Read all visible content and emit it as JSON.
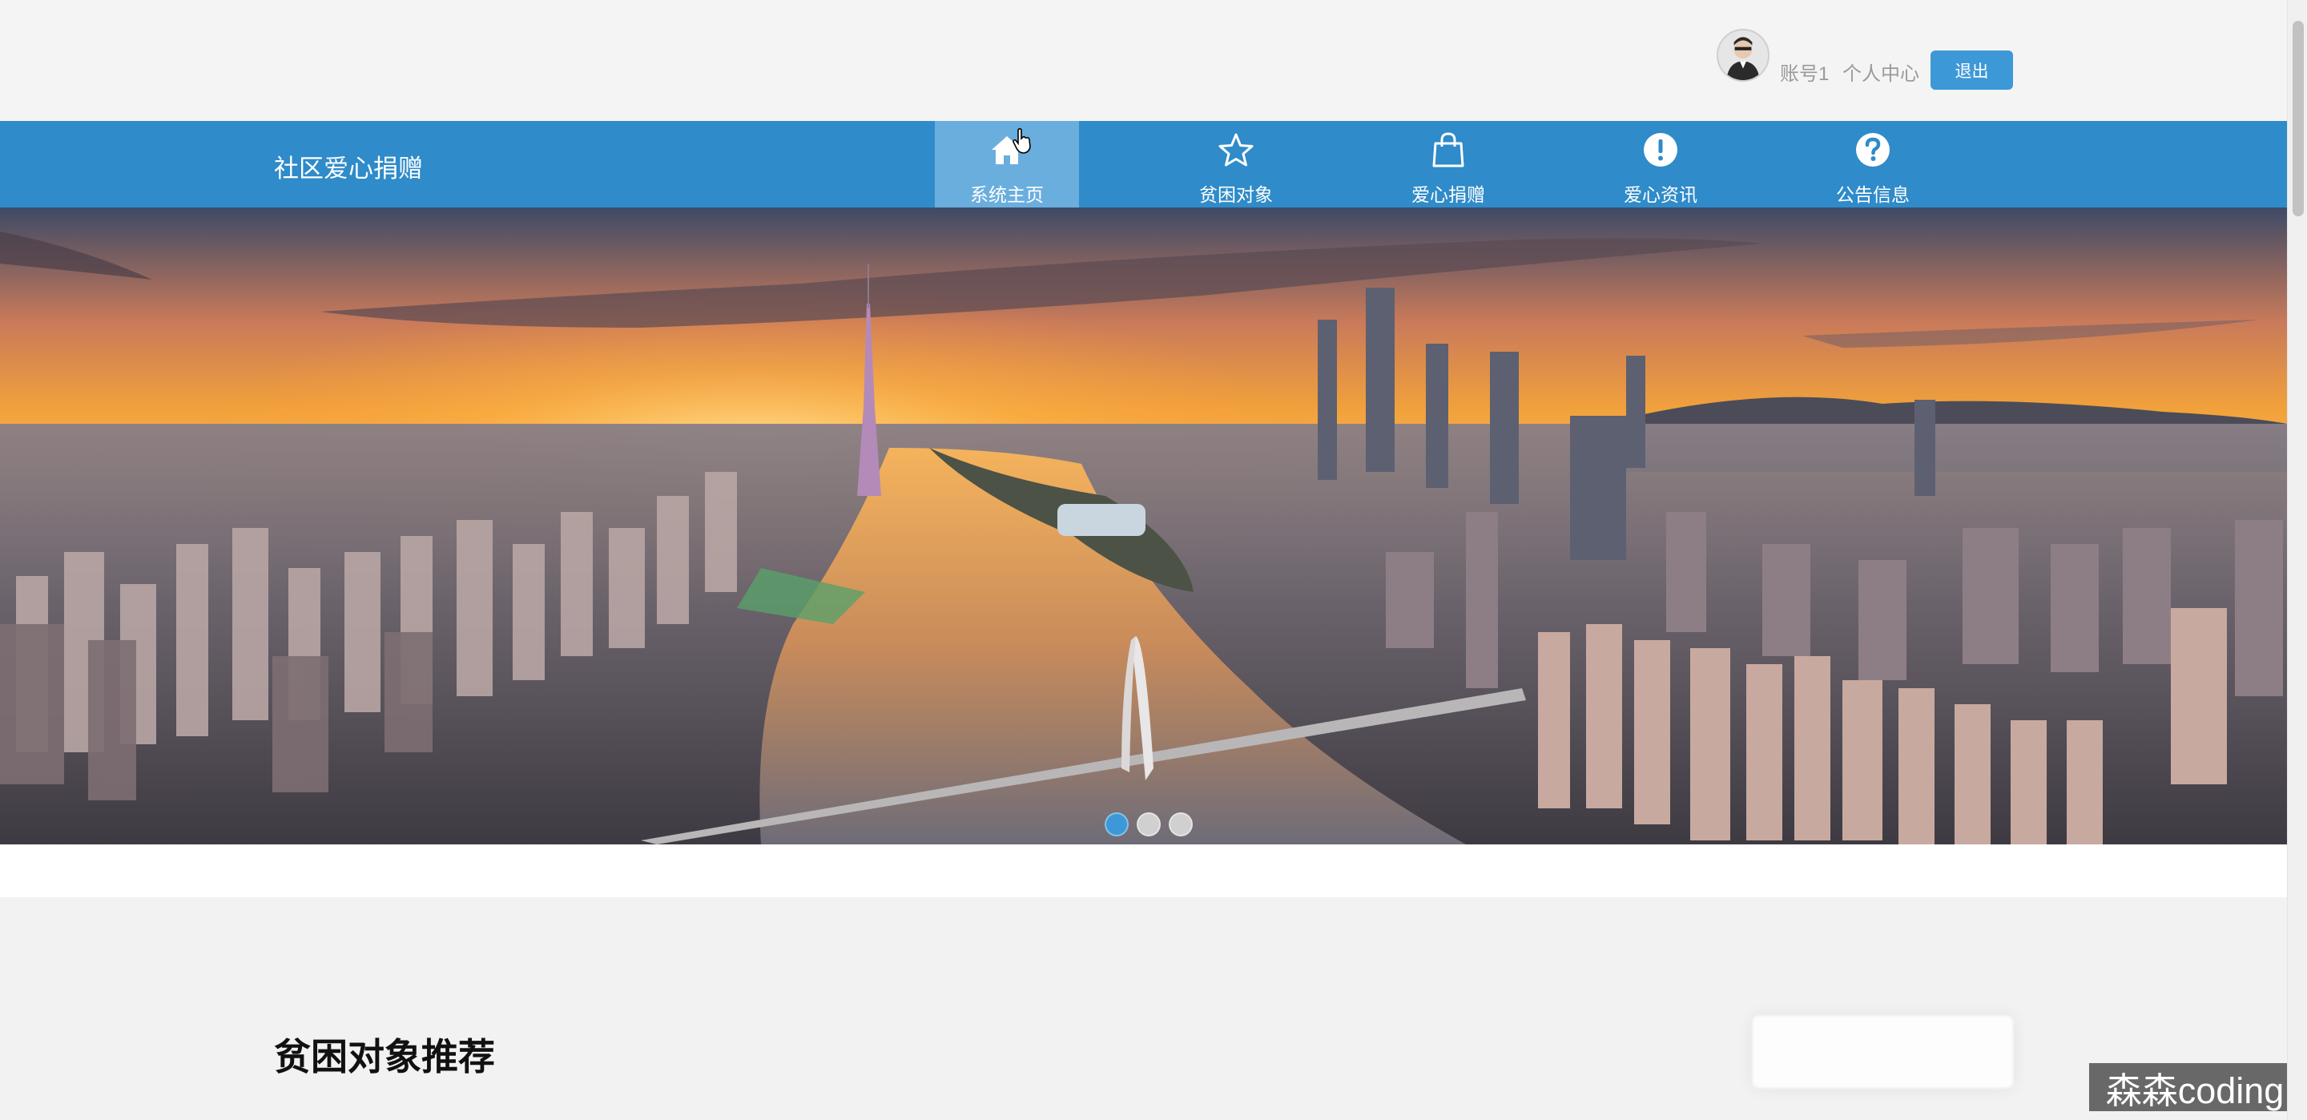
{
  "user": {
    "account_label": "账号1",
    "profile_label": "个人中心",
    "logout_label": "退出"
  },
  "nav": {
    "brand": "社区爱心捐赠",
    "items": [
      {
        "label": "系统主页",
        "icon": "home-icon",
        "active": true
      },
      {
        "label": "贫困对象",
        "icon": "star-icon",
        "active": false
      },
      {
        "label": "爱心捐赠",
        "icon": "shopping-bag-icon",
        "active": false
      },
      {
        "label": "爱心资讯",
        "icon": "exclamation-icon",
        "active": false
      },
      {
        "label": "公告信息",
        "icon": "question-icon",
        "active": false
      }
    ]
  },
  "carousel": {
    "slide_count": 3,
    "active_index": 0
  },
  "sections": {
    "poverty_recommend_title": "贫困对象推荐"
  },
  "watermark": "森森coding",
  "colors": {
    "nav_bg": "#2f8bc9",
    "nav_active_bg": "#6aaede",
    "button_blue": "#3d98d8",
    "page_bg": "#f2f2f2"
  }
}
